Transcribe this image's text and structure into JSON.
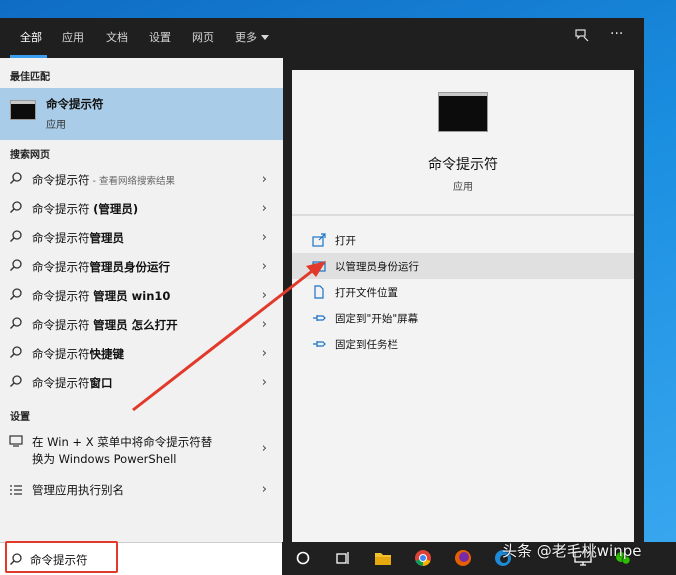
{
  "tabs": [
    {
      "label": "全部"
    },
    {
      "label": "应用"
    },
    {
      "label": "文档"
    },
    {
      "label": "设置"
    },
    {
      "label": "网页"
    },
    {
      "label": "更多"
    }
  ],
  "topbar_icons": {
    "feedback": "feedback-icon",
    "more": "···"
  },
  "best_match": {
    "section": "最佳匹配",
    "title": "命令提示符",
    "subtitle": "应用"
  },
  "web_search": {
    "section": "搜索网页",
    "items": [
      {
        "main": "命令提示符",
        "bold": "",
        "hint": " - 查看网络搜索结果"
      },
      {
        "main": "命令提示符 ",
        "bold": "(管理员)",
        "hint": ""
      },
      {
        "main": "命令提示符",
        "bold": "管理员",
        "hint": ""
      },
      {
        "main": "命令提示符",
        "bold": "管理员身份运行",
        "hint": ""
      },
      {
        "main": "命令提示符 ",
        "bold": "管理员 win10",
        "hint": ""
      },
      {
        "main": "命令提示符 ",
        "bold": "管理员 怎么打开",
        "hint": ""
      },
      {
        "main": "命令提示符",
        "bold": "快捷键",
        "hint": ""
      },
      {
        "main": "命令提示符",
        "bold": "窗口",
        "hint": ""
      }
    ]
  },
  "settings": {
    "section": "设置",
    "items": [
      {
        "line1": "在 Win + X 菜单中将命令提示符替",
        "line2": "换为 Windows PowerShell"
      },
      {
        "line1": "管理应用执行别名",
        "line2": ""
      }
    ]
  },
  "details": {
    "title": "命令提示符",
    "subtitle": "应用",
    "actions": [
      {
        "label": "打开",
        "icon": "open-icon"
      },
      {
        "label": "以管理员身份运行",
        "icon": "run-as-admin-icon"
      },
      {
        "label": "打开文件位置",
        "icon": "file-location-icon"
      },
      {
        "label": "固定到\"开始\"屏幕",
        "icon": "pin-start-icon"
      },
      {
        "label": "固定到任务栏",
        "icon": "pin-taskbar-icon"
      }
    ]
  },
  "search": {
    "value": "命令提示符"
  },
  "watermark": "头条 @老毛桃winpe",
  "colors": {
    "accent": "#3a9df0",
    "highlight": "#a9cde8",
    "annotation": "#e23a2a"
  }
}
